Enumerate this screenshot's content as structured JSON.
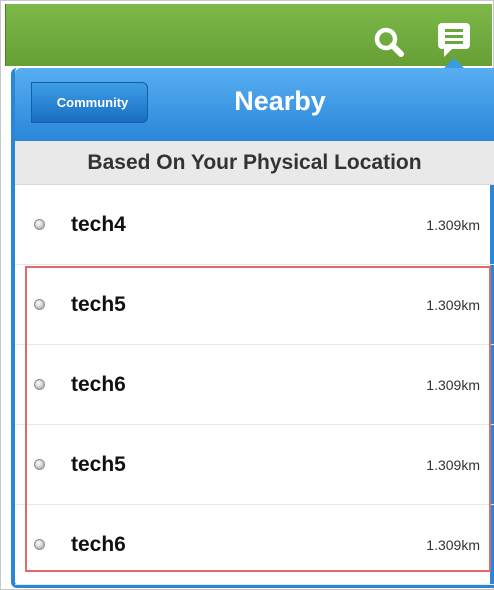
{
  "header": {
    "back_label": "Community",
    "title": "Nearby",
    "subtitle": "Based On Your Physical Location"
  },
  "icons": {
    "search": "search-icon",
    "menu": "chat-menu-icon"
  },
  "colors": {
    "app_bar": "#6aa83a",
    "popover_blue": "#2a86d8",
    "highlight": "#e06a6a"
  },
  "list": [
    {
      "name": "tech4",
      "distance": "1.309km"
    },
    {
      "name": "tech5",
      "distance": "1.309km"
    },
    {
      "name": "tech6",
      "distance": "1.309km"
    },
    {
      "name": "tech5",
      "distance": "1.309km"
    },
    {
      "name": "tech6",
      "distance": "1.309km"
    }
  ]
}
